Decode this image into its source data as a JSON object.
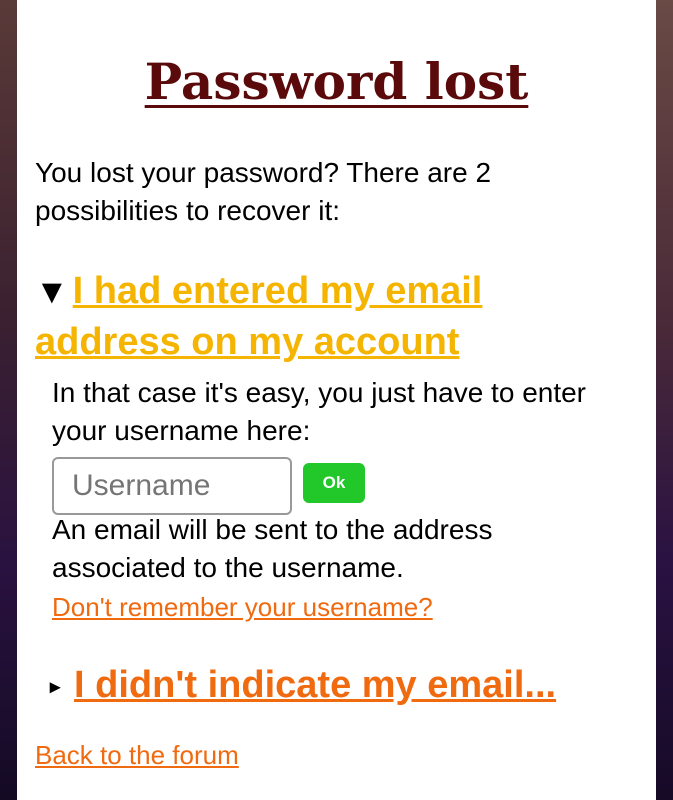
{
  "page": {
    "title": "Password lost",
    "intro": "You lost your password? There are 2 possibilities to recover it:"
  },
  "section1": {
    "arrow": "▼",
    "heading": "I had entered my email address on my account",
    "instructions": "In that case it's easy, you just have to enter your username here:",
    "username_placeholder": "Username",
    "ok_label": "Ok",
    "note": "An email will be sent to the address associated to the username.",
    "forgot_link": "Don't remember your username?"
  },
  "section2": {
    "arrow": "▸",
    "heading": "I didn't indicate my email..."
  },
  "footer": {
    "back_link": "Back to the forum"
  },
  "colors": {
    "title": "#5a0a0a",
    "section1_link": "#f4b400",
    "link": "#f06a10",
    "ok_button": "#22c82a"
  }
}
